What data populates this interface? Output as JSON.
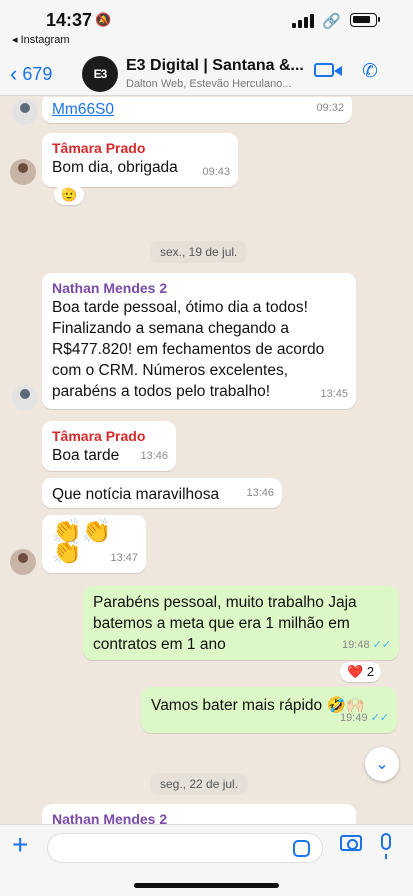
{
  "status_bar": {
    "time": "14:37",
    "back_app": "◂ Instagram"
  },
  "header": {
    "back_count": "679",
    "avatar_text": "E3",
    "title": "E3 Digital | Santana &...",
    "subtitle": "Dalton Web, Estevão Herculano..."
  },
  "messages": {
    "m1": {
      "link": "Mm66S0",
      "time": "09:32"
    },
    "m2": {
      "sender": "Tâmara Prado",
      "text": "Bom dia, obrigada",
      "time": "09:43",
      "reaction": "🫡"
    },
    "date1": "sex., 19 de jul.",
    "m3": {
      "sender": "Nathan Mendes 2",
      "lines": [
        "Boa tarde pessoal, ótimo dia a todos!",
        "Finalizando a semana chegando a",
        "R$477.820! em fechamentos de acordo",
        "com o CRM. Números excelentes,",
        "parabéns a todos pelo trabalho!"
      ],
      "time": "13:45"
    },
    "m4": {
      "sender": "Tâmara Prado",
      "text": "Boa tarde",
      "time": "13:46"
    },
    "m5": {
      "text": "Que notícia maravilhosa",
      "time": "13:46"
    },
    "m6": {
      "text": "👏👏👏",
      "time": "13:47"
    },
    "m7": {
      "lines": [
        "Parabéns pessoal, muito trabalho Jaja",
        "batemos a meta que era 1 milhão em",
        "contratos em 1 ano"
      ],
      "time": "19:48",
      "reaction": "❤️",
      "reaction_count": "2"
    },
    "m8": {
      "text": "Vamos bater mais rápido 🤣🙌🏻",
      "time": "19:49"
    },
    "date2": "seg., 22 de jul.",
    "m9": {
      "sender": "Nathan Mendes 2"
    }
  },
  "colors": {
    "accent": "#1a73e8",
    "outgoing_bubble": "#dcf8c6",
    "chat_bg": "#efe7de",
    "sender_red": "#d42a2a",
    "sender_purple": "#7b4aa8"
  }
}
